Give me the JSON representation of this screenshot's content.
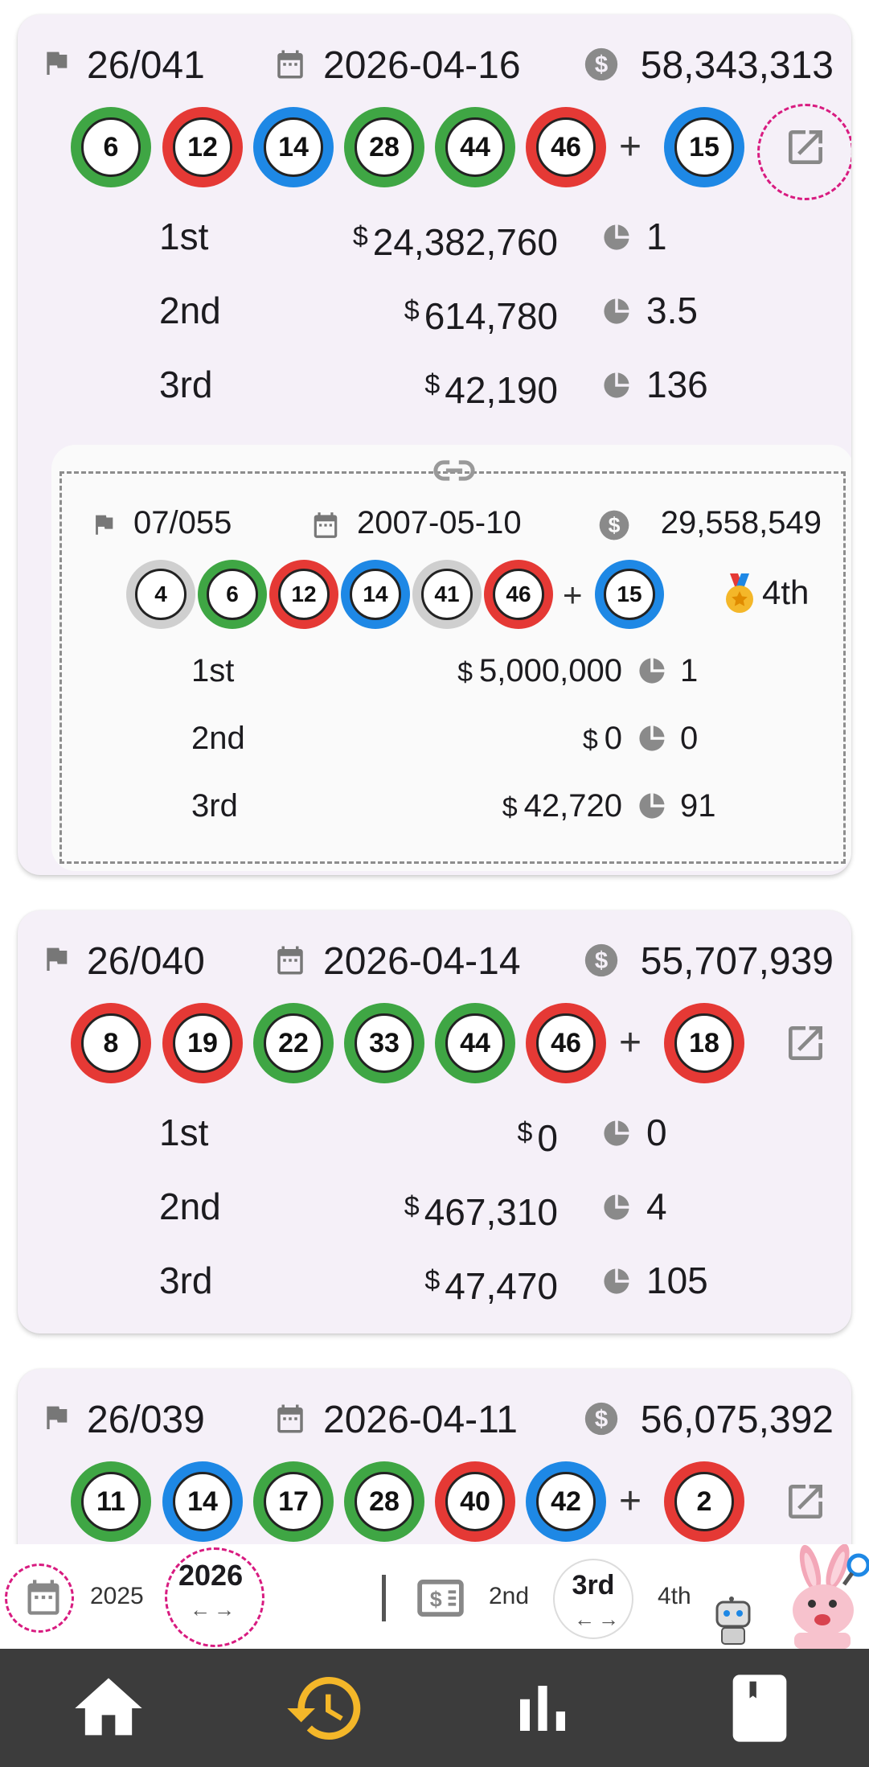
{
  "cards": [
    {
      "draw": "26/041",
      "date": "2026-04-16",
      "pool": "58,343,313",
      "balls": [
        {
          "n": "6",
          "color": "green"
        },
        {
          "n": "12",
          "color": "red"
        },
        {
          "n": "14",
          "color": "blue"
        },
        {
          "n": "28",
          "color": "green"
        },
        {
          "n": "44",
          "color": "green"
        },
        {
          "n": "46",
          "color": "red"
        }
      ],
      "bonus": {
        "n": "15",
        "color": "blue"
      },
      "plus": "+",
      "prizes": [
        {
          "tier": "1st",
          "currency": "$",
          "amount": "24,382,760",
          "winners": "1"
        },
        {
          "tier": "2nd",
          "currency": "$",
          "amount": "614,780",
          "winners": "3.5"
        },
        {
          "tier": "3rd",
          "currency": "$",
          "amount": "42,190",
          "winners": "136"
        }
      ],
      "linked": {
        "draw": "07/055",
        "date": "2007-05-10",
        "pool": "29,558,549",
        "balls": [
          {
            "n": "4",
            "color": "grey"
          },
          {
            "n": "6",
            "color": "green"
          },
          {
            "n": "12",
            "color": "red"
          },
          {
            "n": "14",
            "color": "blue"
          },
          {
            "n": "41",
            "color": "grey"
          },
          {
            "n": "46",
            "color": "red"
          }
        ],
        "bonus": {
          "n": "15",
          "color": "blue"
        },
        "plus": "+",
        "rank": "4th",
        "prizes": [
          {
            "tier": "1st",
            "currency": "$",
            "amount": "5,000,000",
            "winners": "1"
          },
          {
            "tier": "2nd",
            "currency": "$",
            "amount": "0",
            "winners": "0"
          },
          {
            "tier": "3rd",
            "currency": "$",
            "amount": "42,720",
            "winners": "91"
          }
        ]
      }
    },
    {
      "draw": "26/040",
      "date": "2026-04-14",
      "pool": "55,707,939",
      "balls": [
        {
          "n": "8",
          "color": "red"
        },
        {
          "n": "19",
          "color": "red"
        },
        {
          "n": "22",
          "color": "green"
        },
        {
          "n": "33",
          "color": "green"
        },
        {
          "n": "44",
          "color": "green"
        },
        {
          "n": "46",
          "color": "red"
        }
      ],
      "bonus": {
        "n": "18",
        "color": "red"
      },
      "plus": "+",
      "prizes": [
        {
          "tier": "1st",
          "currency": "$",
          "amount": "0",
          "winners": "0"
        },
        {
          "tier": "2nd",
          "currency": "$",
          "amount": "467,310",
          "winners": "4"
        },
        {
          "tier": "3rd",
          "currency": "$",
          "amount": "47,470",
          "winners": "105"
        }
      ]
    },
    {
      "draw": "26/039",
      "date": "2026-04-11",
      "pool": "56,075,392",
      "balls": [
        {
          "n": "11",
          "color": "green"
        },
        {
          "n": "14",
          "color": "blue"
        },
        {
          "n": "17",
          "color": "green"
        },
        {
          "n": "28",
          "color": "green"
        },
        {
          "n": "40",
          "color": "red"
        },
        {
          "n": "42",
          "color": "blue"
        }
      ],
      "bonus": {
        "n": "2",
        "color": "red"
      },
      "plus": "+"
    }
  ],
  "filter": {
    "year_prev": "2025",
    "year_selected": "2026",
    "arrows": "←→",
    "tier_prev": "2nd",
    "tier_selected": "3rd",
    "tier_next": "4th"
  },
  "nav": [
    "home-icon",
    "history-icon",
    "stats-icon",
    "bookmark-icon"
  ],
  "colors": {
    "accent": "#f4b729",
    "highlight": "#d81b80",
    "nav_bg": "#3c3c3c"
  }
}
